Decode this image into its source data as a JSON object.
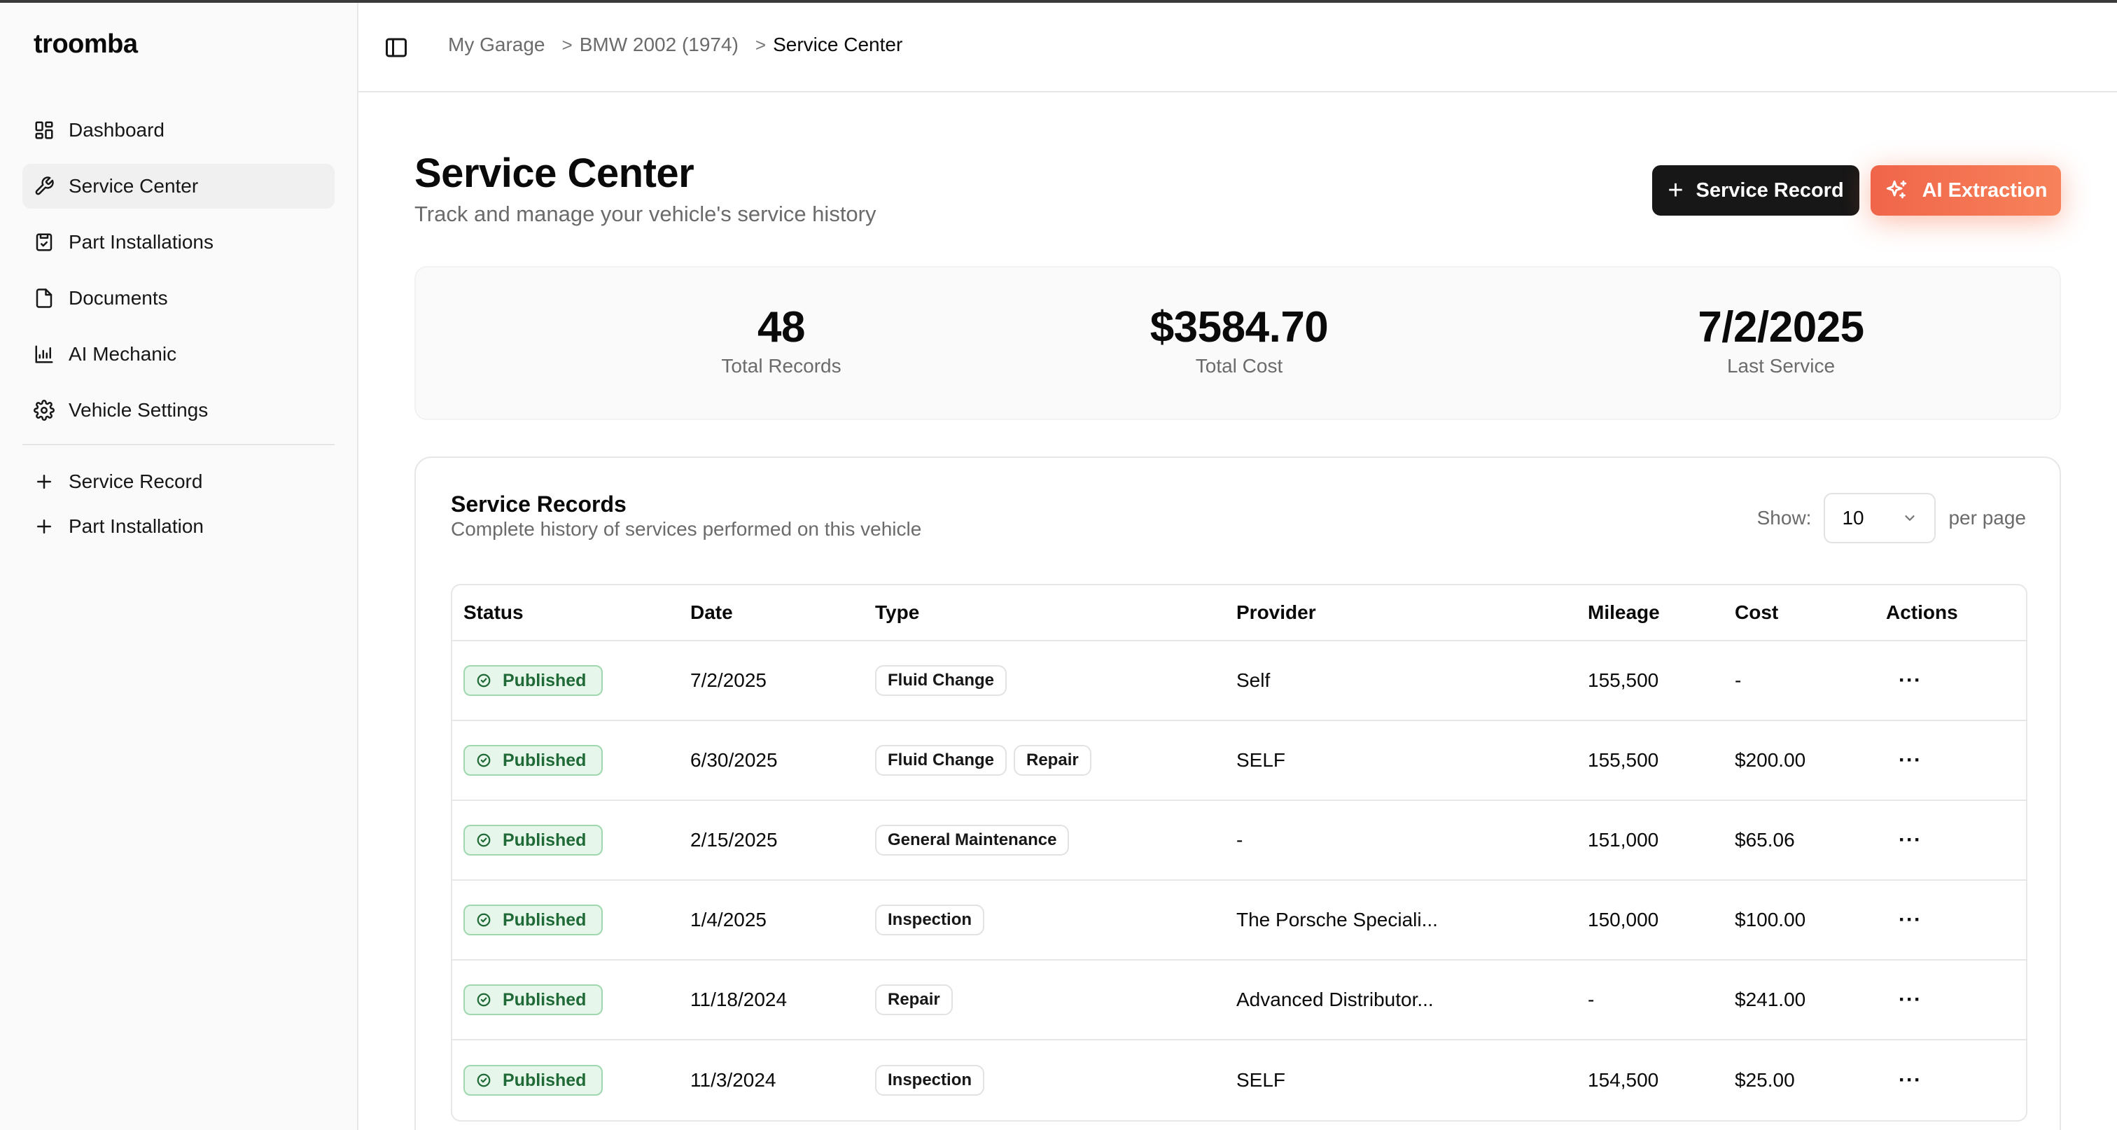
{
  "app": {
    "brand": "troomba"
  },
  "sidebar": {
    "items": [
      {
        "label": "Dashboard",
        "icon": "dashboard-icon"
      },
      {
        "label": "Service Center",
        "icon": "wrench-icon",
        "active": true
      },
      {
        "label": "Part Installations",
        "icon": "clipboard-check-icon"
      },
      {
        "label": "Documents",
        "icon": "file-icon"
      },
      {
        "label": "AI Mechanic",
        "icon": "chart-icon"
      },
      {
        "label": "Vehicle Settings",
        "icon": "gear-icon"
      }
    ],
    "actions": [
      {
        "label": "Service Record",
        "icon": "plus-icon"
      },
      {
        "label": "Part Installation",
        "icon": "plus-icon"
      }
    ]
  },
  "breadcrumb": {
    "items": [
      "My Garage",
      "BMW 2002 (1974)",
      "Service Center"
    ],
    "separator": ">"
  },
  "page": {
    "title": "Service Center",
    "subtitle": "Track and manage your vehicle's service history",
    "add_button": "Service Record",
    "ai_button": "AI Extraction"
  },
  "stats": [
    {
      "value": "48",
      "label": "Total Records"
    },
    {
      "value": "$3584.70",
      "label": "Total Cost"
    },
    {
      "value": "7/2/2025",
      "label": "Last Service"
    }
  ],
  "records": {
    "title": "Service Records",
    "subtitle": "Complete history of services performed on this vehicle",
    "show_label": "Show:",
    "per_page_value": "10",
    "per_page_label": "per page",
    "columns": [
      "Status",
      "Date",
      "Type",
      "Provider",
      "Mileage",
      "Cost",
      "Actions"
    ],
    "actions_glyph": "···",
    "rows": [
      {
        "status": "Published",
        "date": "7/2/2025",
        "types": [
          "Fluid Change"
        ],
        "provider": "Self",
        "mileage": "155,500",
        "cost": "-"
      },
      {
        "status": "Published",
        "date": "6/30/2025",
        "types": [
          "Fluid Change",
          "Repair"
        ],
        "provider": "SELF",
        "mileage": "155,500",
        "cost": "$200.00"
      },
      {
        "status": "Published",
        "date": "2/15/2025",
        "types": [
          "General Maintenance"
        ],
        "provider": "-",
        "mileage": "151,000",
        "cost": "$65.06"
      },
      {
        "status": "Published",
        "date": "1/4/2025",
        "types": [
          "Inspection"
        ],
        "provider": "The Porsche Speciali...",
        "mileage": "150,000",
        "cost": "$100.00"
      },
      {
        "status": "Published",
        "date": "11/18/2024",
        "types": [
          "Repair"
        ],
        "provider": "Advanced Distributor...",
        "mileage": "-",
        "cost": "$241.00"
      },
      {
        "status": "Published",
        "date": "11/3/2024",
        "types": [
          "Inspection"
        ],
        "provider": "SELF",
        "mileage": "154,500",
        "cost": "$25.00"
      }
    ]
  },
  "colors": {
    "accent_dark": "#171717",
    "ai_gradient_start": "#f0654a",
    "ai_gradient_end": "#f7825a",
    "status_published_bg": "#e6f6ea",
    "status_published_text": "#1f6a36"
  }
}
